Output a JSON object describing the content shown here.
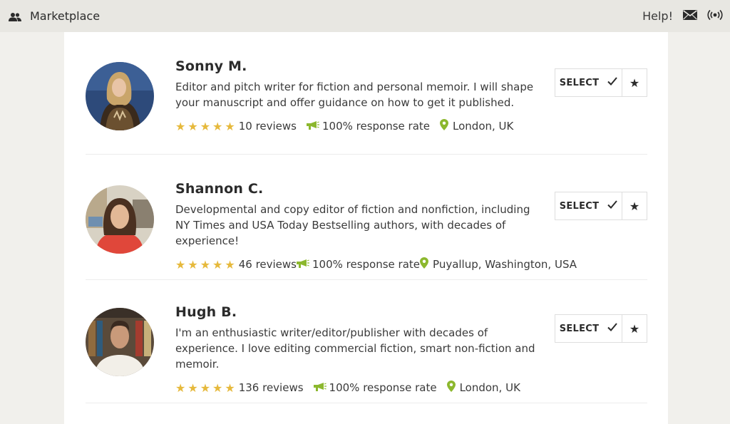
{
  "topbar": {
    "brand_icon": "users-icon",
    "brand_label": "Marketplace",
    "help_label": "Help!",
    "mail_icon": "mail-icon",
    "signal_icon": "broadcast-icon"
  },
  "colors": {
    "star": "#e6b93c",
    "accent_green": "#8cb82e",
    "topbar_bg": "#e8e7e2",
    "page_bg": "#f1f0ec"
  },
  "editors": [
    {
      "name": "Sonny M.",
      "description": "Editor and pitch writer for fiction and personal memoir. I will shape your manuscript and offer guidance on how to get it published.",
      "rating": 5,
      "reviews": "10 reviews",
      "response_rate": "100% response rate",
      "location": "London, UK",
      "select_label": "SELECT"
    },
    {
      "name": "Shannon C.",
      "description": "Developmental and copy editor of fiction and nonfiction, including NY Times and USA Today Bestselling authors, with decades of experience!",
      "rating": 5,
      "reviews": "46 reviews",
      "response_rate": "100% response rate",
      "location": "Puyallup, Washington, USA",
      "select_label": "SELECT"
    },
    {
      "name": "Hugh B.",
      "description": "I'm an enthusiastic writer/editor/publisher with decades of experience. I love editing commercial fiction, smart non-fiction and memoir.",
      "rating": 5,
      "reviews": "136 reviews",
      "response_rate": "100% response rate",
      "location": "London, UK",
      "select_label": "SELECT"
    }
  ]
}
